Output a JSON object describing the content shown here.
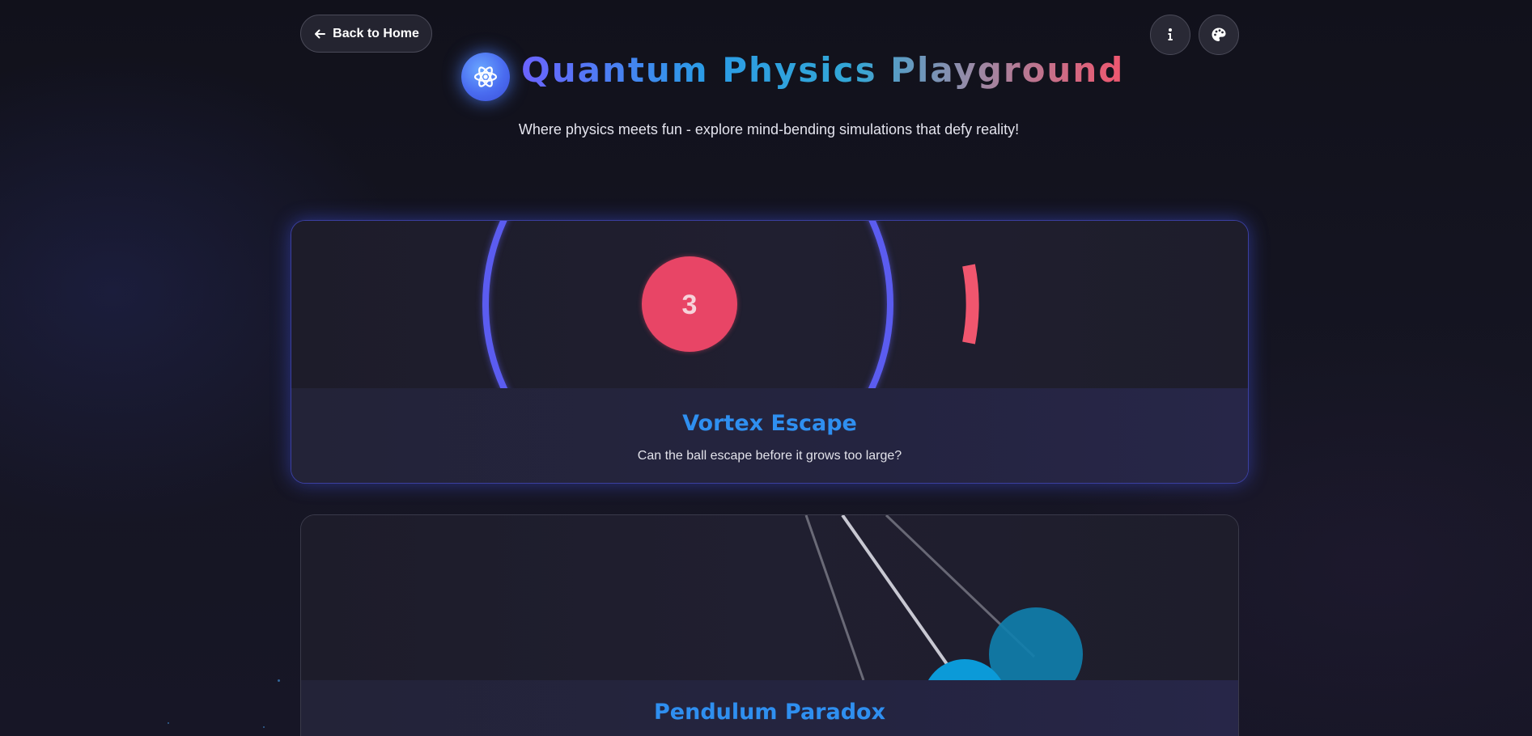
{
  "nav": {
    "back_label": "Back to Home"
  },
  "header": {
    "title": "Quantum Physics Playground",
    "subtitle": "Where physics meets fun - explore mind-bending simulations that defy reality!"
  },
  "cards": [
    {
      "title": "Vortex Escape",
      "description": "Can the ball escape before it grows too large?",
      "ball_label": "3"
    },
    {
      "title": "Pendulum Paradox"
    }
  ],
  "icons": {
    "back": "arrow-left-icon",
    "info": "info-icon",
    "theme": "palette-icon",
    "logo": "atom-icon"
  },
  "colors": {
    "accent_blue": "#2f8ff0",
    "vortex_ring": "#5b5cf0",
    "vortex_gap": "#f0566e",
    "ball": "#e84566",
    "pendulum_ball": "#0b9ad8"
  }
}
